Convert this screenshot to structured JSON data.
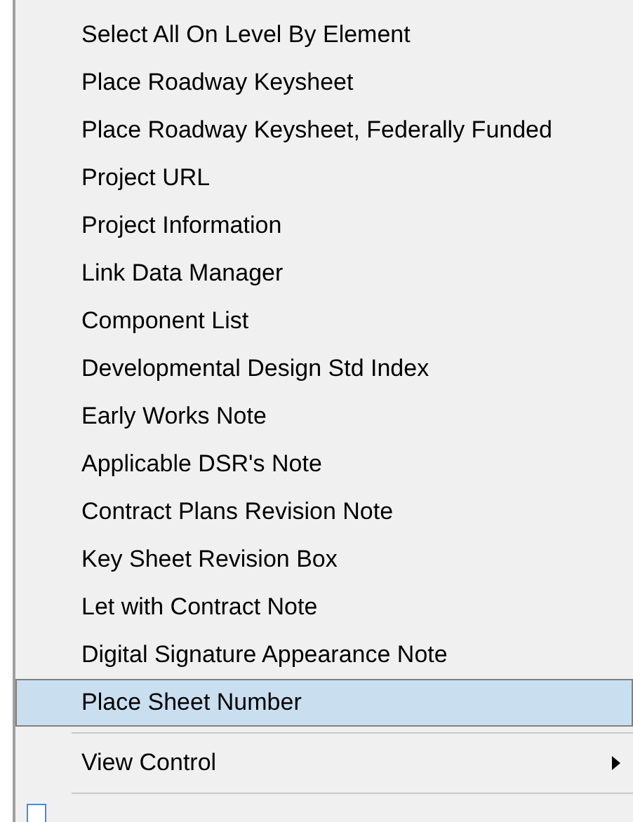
{
  "menu": {
    "items": [
      {
        "kind": "command",
        "label": "Select All On Level By Element",
        "selected": false
      },
      {
        "kind": "command",
        "label": "Place Roadway Keysheet",
        "selected": false
      },
      {
        "kind": "command",
        "label": "Place Roadway Keysheet, Federally Funded",
        "selected": false
      },
      {
        "kind": "command",
        "label": "Project URL",
        "selected": false
      },
      {
        "kind": "command",
        "label": "Project Information",
        "selected": false
      },
      {
        "kind": "command",
        "label": "Link Data Manager",
        "selected": false
      },
      {
        "kind": "command",
        "label": "Component List",
        "selected": false
      },
      {
        "kind": "command",
        "label": "Developmental Design Std Index",
        "selected": false
      },
      {
        "kind": "command",
        "label": "Early Works Note",
        "selected": false
      },
      {
        "kind": "command",
        "label": "Applicable DSR's Note",
        "selected": false
      },
      {
        "kind": "command",
        "label": "Contract Plans Revision Note",
        "selected": false
      },
      {
        "kind": "command",
        "label": "Key Sheet Revision Box",
        "selected": false
      },
      {
        "kind": "command",
        "label": "Let with Contract Note",
        "selected": false
      },
      {
        "kind": "command",
        "label": "Digital Signature Appearance Note",
        "selected": false
      },
      {
        "kind": "command",
        "label": "Place Sheet Number",
        "selected": true
      },
      {
        "kind": "separator"
      },
      {
        "kind": "submenu",
        "label": "View Control",
        "selected": false
      },
      {
        "kind": "separator"
      },
      {
        "kind": "checkbox",
        "checked": false
      }
    ]
  }
}
